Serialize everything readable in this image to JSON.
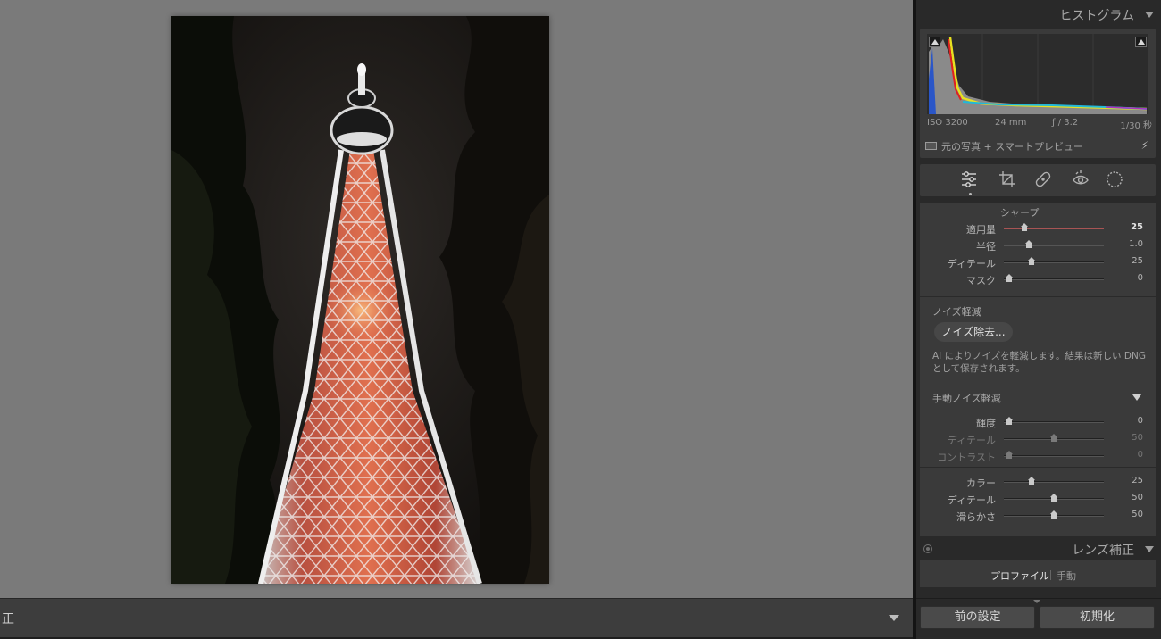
{
  "toolbar": {
    "label": "正",
    "menu_icon": "triangle-down-icon"
  },
  "histogram": {
    "title": "ヒストグラム",
    "exif": {
      "iso": "ISO 3200",
      "focal": "24 mm",
      "aperture": "ƒ / 3.2",
      "shutter": "1/30 秒"
    },
    "preview_label": "元の写真 + スマートプレビュー"
  },
  "tools": [
    "sliders-icon",
    "crop-icon",
    "healing-icon",
    "redeye-icon",
    "mask-icon"
  ],
  "sharpening": {
    "title": "シャープ",
    "sliders": [
      {
        "label": "適用量",
        "value": "25",
        "fraction": 0.167
      },
      {
        "label": "半径",
        "value": "1.0",
        "fraction": 0.222
      },
      {
        "label": "ディテール",
        "value": "25",
        "fraction": 0.25
      },
      {
        "label": "マスク",
        "value": "0",
        "fraction": 0.0
      }
    ]
  },
  "noise": {
    "title": "ノイズ軽減",
    "ai_button": "ノイズ除去...",
    "ai_note": "AI によりノイズを軽減します。結果は新しい DNG として保存されます。",
    "manual_title": "手動ノイズ軽減",
    "luminance_sliders": [
      {
        "label": "輝度",
        "value": "0",
        "fraction": 0.0
      },
      {
        "label": "ディテール",
        "value": "50",
        "fraction": 0.5
      },
      {
        "label": "コントラスト",
        "value": "0",
        "fraction": 0.0
      }
    ],
    "color_sliders": [
      {
        "label": "カラー",
        "value": "25",
        "fraction": 0.25
      },
      {
        "label": "ディテール",
        "value": "50",
        "fraction": 0.5
      },
      {
        "label": "滑らかさ",
        "value": "50",
        "fraction": 0.5
      }
    ]
  },
  "lens": {
    "title": "レンズ補正",
    "tabs": [
      "プロファイル",
      "手動"
    ]
  },
  "buttons": {
    "previous": "前の設定",
    "reset": "初期化"
  },
  "colors": {
    "panel_bg": "#292929",
    "viewer_bg": "#7a7a7a",
    "accent_track": "#8e3a3a"
  }
}
